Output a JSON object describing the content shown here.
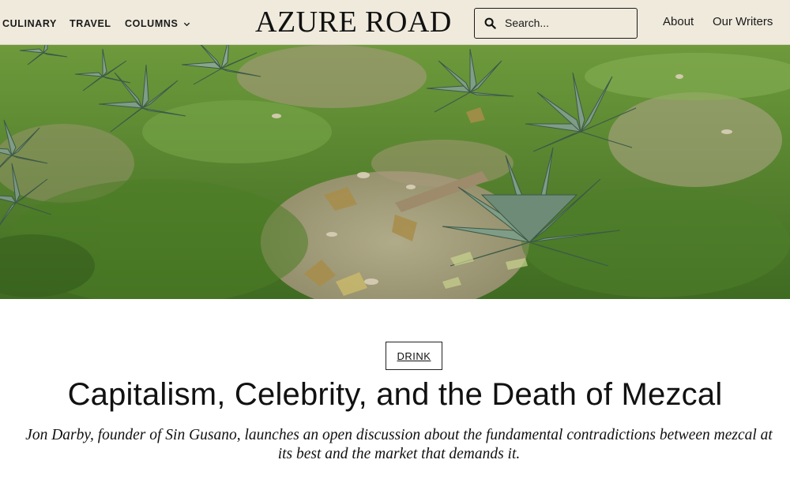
{
  "header": {
    "nav_left": [
      {
        "label": "CULINARY"
      },
      {
        "label": "TRAVEL"
      },
      {
        "label": "COLUMNS"
      }
    ],
    "logo": "AZURE ROAD",
    "search": {
      "placeholder": "Search..."
    },
    "nav_right": [
      {
        "label": "About"
      },
      {
        "label": "Our Writers"
      }
    ]
  },
  "hero": {
    "icon": "agave-field-photo"
  },
  "article": {
    "category": "DRINK",
    "title": "Capitalism, Celebrity, and the Death of Mezcal",
    "subtitle": "Jon Darby, founder of Sin Gusano, launches an open discussion about the fundamental contradictions between mezcal at its best and the market that demands it."
  },
  "colors": {
    "header_bg": "#efeadc",
    "text": "#111111",
    "grass": "#5c8a32",
    "agave": "#6f8f7a",
    "soil": "#b7a98f"
  }
}
